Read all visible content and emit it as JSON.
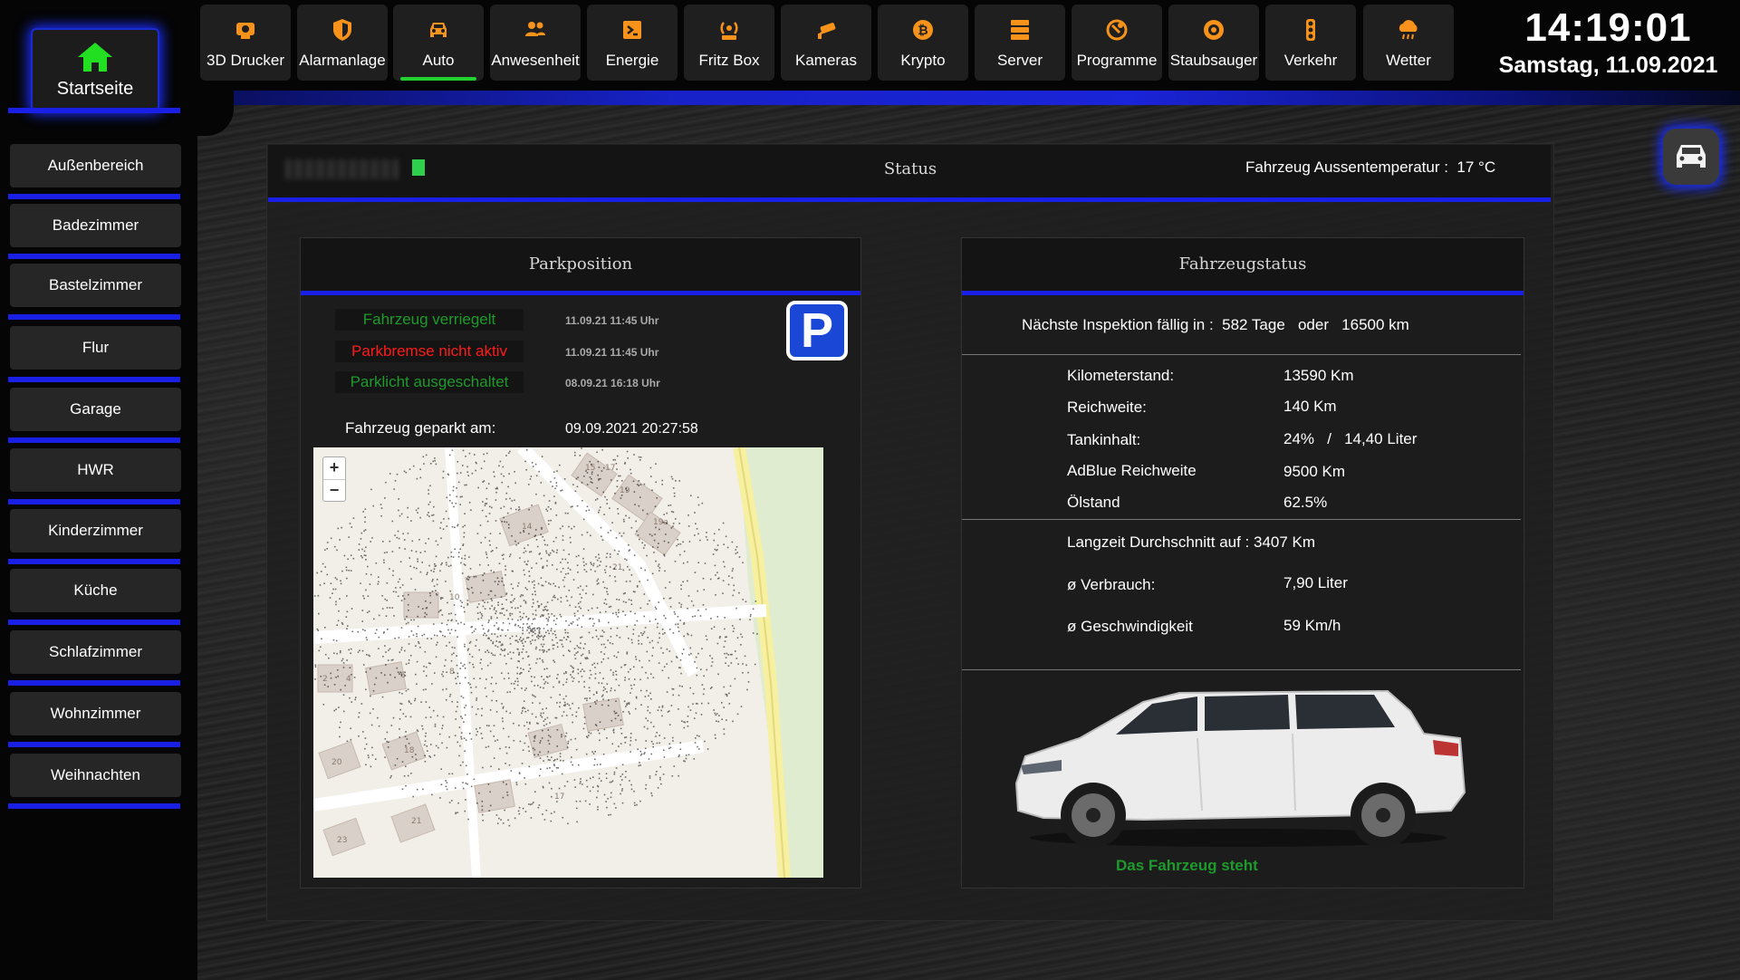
{
  "sidebar": {
    "home_label": "Startseite",
    "rooms": [
      "Außenbereich",
      "Badezimmer",
      "Bastelzimmer",
      "Flur",
      "Garage",
      "HWR",
      "Kinderzimmer",
      "Küche",
      "Schlafzimmer",
      "Wohnzimmer",
      "Weihnachten"
    ]
  },
  "nav": {
    "tabs": [
      {
        "label": "3D Drucker",
        "icon": "printer-icon"
      },
      {
        "label": "Alarmanlage",
        "icon": "shield-icon"
      },
      {
        "label": "Auto",
        "icon": "car-icon",
        "active": true
      },
      {
        "label": "Anwesenheit",
        "icon": "people-icon"
      },
      {
        "label": "Energie",
        "icon": "energy-icon"
      },
      {
        "label": "Fritz Box",
        "icon": "router-icon"
      },
      {
        "label": "Kameras",
        "icon": "camera-icon"
      },
      {
        "label": "Krypto",
        "icon": "bitcoin-icon"
      },
      {
        "label": "Server",
        "icon": "server-icon"
      },
      {
        "label": "Programme",
        "icon": "programs-icon"
      },
      {
        "label": "Staubsauger",
        "icon": "vacuum-icon"
      },
      {
        "label": "Verkehr",
        "icon": "traffic-light-icon"
      },
      {
        "label": "Wetter",
        "icon": "weather-icon"
      }
    ],
    "accent_color": "#f7931a",
    "active_color": "#22d12f"
  },
  "clock": {
    "time": "14:19:01",
    "date": "Samstag, 11.09.2021"
  },
  "status": {
    "title": "Status",
    "outside_temp_label": "Fahrzeug Aussentemperatur :",
    "outside_temp_value": "17 °C"
  },
  "parking": {
    "title": "Parkposition",
    "states": [
      {
        "text": "Fahrzeug verriegelt",
        "time": "11.09.21 11:45 Uhr",
        "color": "#1e9a2c"
      },
      {
        "text": "Parkbremse nicht aktiv",
        "time": "11.09.21 11:45 Uhr",
        "color": "#ff1a1a"
      },
      {
        "text": "Parklicht ausgeschaltet",
        "time": "08.09.21 16:18 Uhr",
        "color": "#1e9a2c"
      }
    ],
    "parking_icon": "P",
    "parked_label": "Fahrzeug geparkt am:",
    "parked_value": "09.09.2021 20:27:58",
    "map": {
      "zoom_in": "+",
      "zoom_out": "−",
      "house_numbers": [
        "15",
        "17",
        "19",
        "19a",
        "14",
        "21",
        "10",
        "8",
        "6",
        "2",
        "4",
        "20",
        "18",
        "23",
        "21",
        "17"
      ]
    }
  },
  "vehicle": {
    "title": "Fahrzeugstatus",
    "inspection": {
      "label": "Nächste Inspektion fällig in :",
      "days": "582 Tage",
      "or": "oder",
      "km": "16500 km"
    },
    "stats": [
      {
        "label": "Kilometerstand:",
        "value": "13590 Km"
      },
      {
        "label": "Reichweite:",
        "value": "140 Km"
      },
      {
        "label": "Tankinhalt:",
        "value": "24%   /   14,40 Liter"
      },
      {
        "label": "AdBlue Reichweite",
        "value": "9500 Km"
      },
      {
        "label": "Ölstand",
        "value": "62.5%"
      }
    ],
    "longterm_label": "Langzeit Durchschnitt auf : 3407 Km",
    "longterm": [
      {
        "label": "ø Verbrauch:",
        "value": "7,90 Liter"
      },
      {
        "label": "ø Geschwindigkeit",
        "value": "59 Km/h"
      }
    ],
    "state_text": "Das Fahrzeug steht"
  }
}
